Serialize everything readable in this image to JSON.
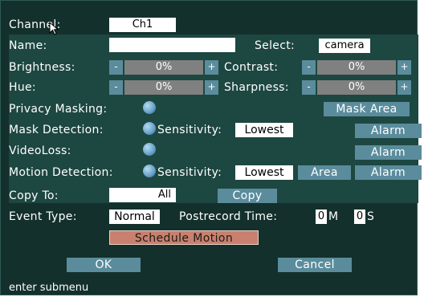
{
  "channel": {
    "label": "Channel:",
    "value": "Ch1"
  },
  "name": {
    "label": "Name:",
    "value": ""
  },
  "select": {
    "label": "Select:",
    "value": "camera"
  },
  "brightness": {
    "label": "Brightness:",
    "value": "0%"
  },
  "contrast": {
    "label": "Contrast:",
    "value": "0%"
  },
  "hue": {
    "label": "Hue:",
    "value": "0%"
  },
  "sharpness": {
    "label": "Sharpness:",
    "value": "0%"
  },
  "slider_minus": "-",
  "slider_plus": "+",
  "privacy_masking": {
    "label": "Privacy Masking:",
    "button": "Mask Area"
  },
  "mask_detection": {
    "label": "Mask Detection:",
    "sensitivity_label": "Sensitivity:",
    "sensitivity": "Lowest",
    "button": "Alarm"
  },
  "video_loss": {
    "label": "VideoLoss:",
    "button": "Alarm"
  },
  "motion_detection": {
    "label": "Motion Detection:",
    "sensitivity_label": "Sensitivity:",
    "sensitivity": "Lowest",
    "area_button": "Area",
    "alarm_button": "Alarm"
  },
  "copy_to": {
    "label": "Copy To:",
    "value": "All",
    "button": "Copy"
  },
  "event_type": {
    "label": "Event Type:",
    "value": "Normal"
  },
  "postrecord": {
    "label": "Postrecord Time:",
    "minutes": "0",
    "minutes_unit": "M",
    "seconds": "0",
    "seconds_unit": "S"
  },
  "schedule_button": "Schedule Motion",
  "ok_button": "OK",
  "cancel_button": "Cancel",
  "status": "enter submenu",
  "colors": {
    "background": "#13302c",
    "panel": "#1d4741",
    "button": "#5a8c9c",
    "schedule": "#c9806e",
    "track": "#808080"
  }
}
